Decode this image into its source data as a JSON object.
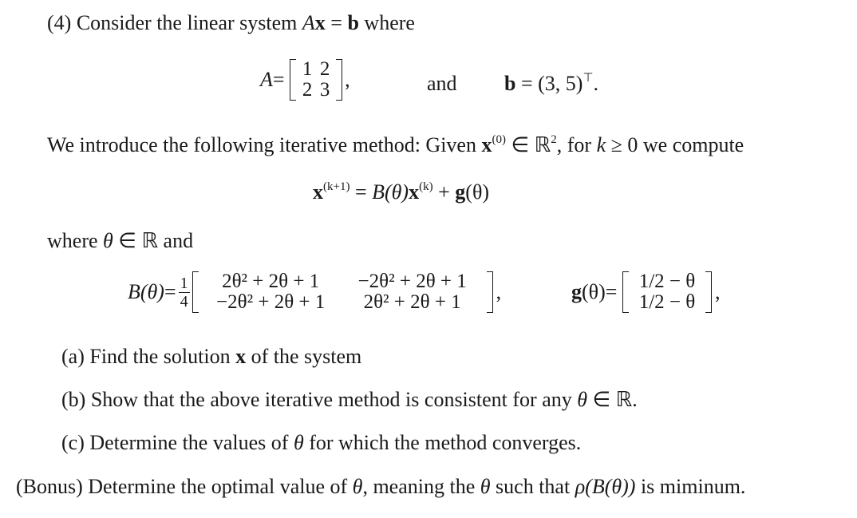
{
  "problem": {
    "number": "(4)",
    "intro": "Consider the linear system",
    "system_eq_lhs_A": "A",
    "system_eq_lhs_x": "x",
    "system_eq_eq": " = ",
    "system_eq_rhs": "b",
    "intro_end": " where",
    "A_label": "A",
    "eq": " = ",
    "A_matrix": [
      "1",
      "2",
      "2",
      "3"
    ],
    "comma": ",",
    "and": "and",
    "b_label": "b",
    "b_value": "(3, 5)",
    "b_transpose": "⊤",
    "period": ".",
    "iter_text_1": "We introduce the following iterative method: Given ",
    "x0": "x",
    "x0_sup": "(0)",
    "in_R2": " ∈ ℝ",
    "R2_sup": "2",
    "iter_text_2": ", for ",
    "k": "k",
    "iter_text_3": " ≥ 0 we compute",
    "update_lhs": "x",
    "update_lhs_sup": "(k+1)",
    "update_eq": " = ",
    "update_B": "B(θ)",
    "update_x": "x",
    "update_x_sup": "(k)",
    "update_plus": " + ",
    "update_g": "g",
    "update_g_arg": "(θ)",
    "where_text": "where ",
    "theta": "θ",
    "where_rest": " ∈ ℝ and",
    "B_label": "B(θ)",
    "frac_num": "1",
    "frac_den": "4",
    "B_matrix": [
      "2θ² + 2θ + 1",
      "−2θ² + 2θ + 1",
      "−2θ² + 2θ + 1",
      "2θ² + 2θ + 1"
    ],
    "g_label": "g",
    "g_arg": "(θ)",
    "g_vector": [
      "1/2 − θ",
      "1/2 − θ"
    ]
  },
  "questions": [
    {
      "label": "(a)",
      "text": "Find the solution ",
      "bold": "x",
      "rest": " of the system"
    },
    {
      "label": "(b)",
      "text": "Show that the above iterative method is consistent for any ",
      "italic": "θ",
      "rest": " ∈ ℝ."
    },
    {
      "label": "(c)",
      "text": "Determine the values of ",
      "italic": "θ",
      "rest": " for which the method converges."
    },
    {
      "label": "(Bonus)",
      "text": "Determine the optimal value of ",
      "italic": "θ",
      "rest": ", meaning the ",
      "italic2": "θ",
      "rest2": " such that ",
      "rho": "ρ(B(θ))",
      "rest3": " is miminum."
    }
  ]
}
